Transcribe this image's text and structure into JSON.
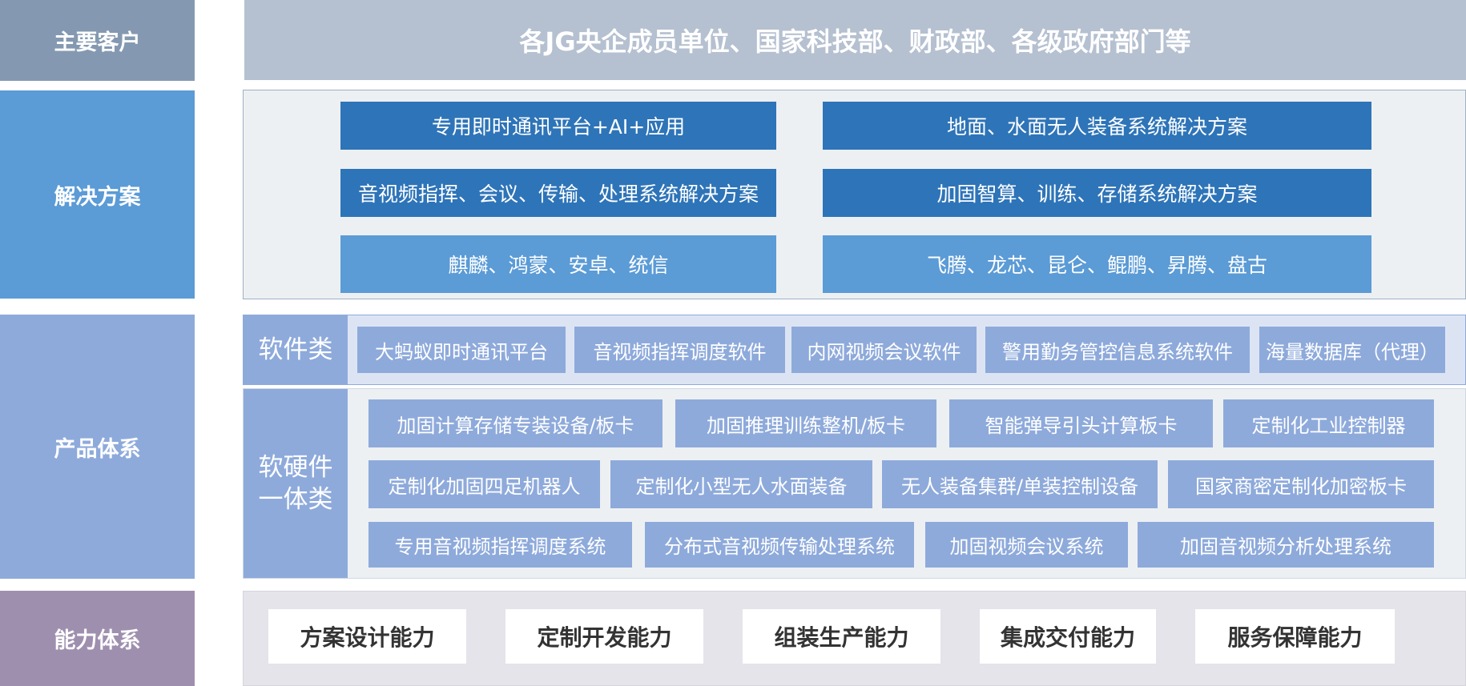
{
  "rows": {
    "customers": {
      "label": "主要客户",
      "text": "各JG央企成员单位、国家科技部、财政部、各级政府部门等"
    },
    "solutions": {
      "label": "解决方案",
      "items": [
        "专用即时通讯平台+AI+应用",
        "地面、水面无人装备系统解决方案",
        "音视频指挥、会议、传输、处理系统解决方案",
        "加固智算、训练、存储系统解决方案",
        "麒麟、鸿蒙、安卓、统信",
        "飞腾、龙芯、昆仑、鲲鹏、昇腾、盘古"
      ]
    },
    "products": {
      "label": "产品体系",
      "software": {
        "label": "软件类",
        "items": [
          "大蚂蚁即时通讯平台",
          "音视频指挥调度软件",
          "内网视频会议软件",
          "警用勤务管控信息系统软件",
          "海量数据库（代理）"
        ]
      },
      "hardware": {
        "label_line1": "软硬件",
        "label_line2": "一体类",
        "items": [
          "加固计算存储专装设备/板卡",
          "加固推理训练整机/板卡",
          "智能弹导引头计算板卡",
          "定制化工业控制器",
          "定制化加固四足机器人",
          "定制化小型无人水面装备",
          "无人装备集群/单装控制设备",
          "国家商密定制化加密板卡",
          "专用音视频指挥调度系统",
          "分布式音视频传输处理系统",
          "加固视频会议系统",
          "加固音视频分析处理系统"
        ]
      }
    },
    "capabilities": {
      "label": "能力体系",
      "items": [
        "方案设计能力",
        "定制开发能力",
        "组装生产能力",
        "集成交付能力",
        "服务保障能力"
      ]
    }
  },
  "colors": {
    "customers_label": "#8499b1",
    "customers_panel": "#b5c0d0",
    "solutions_label": "#5b9bd6",
    "solutions_dark": "#2e74b8",
    "solutions_light": "#5b9bd6",
    "products": "#8eaadb",
    "capabilities_label": "#9f8faf",
    "capabilities_panel": "#e5e4ea"
  }
}
